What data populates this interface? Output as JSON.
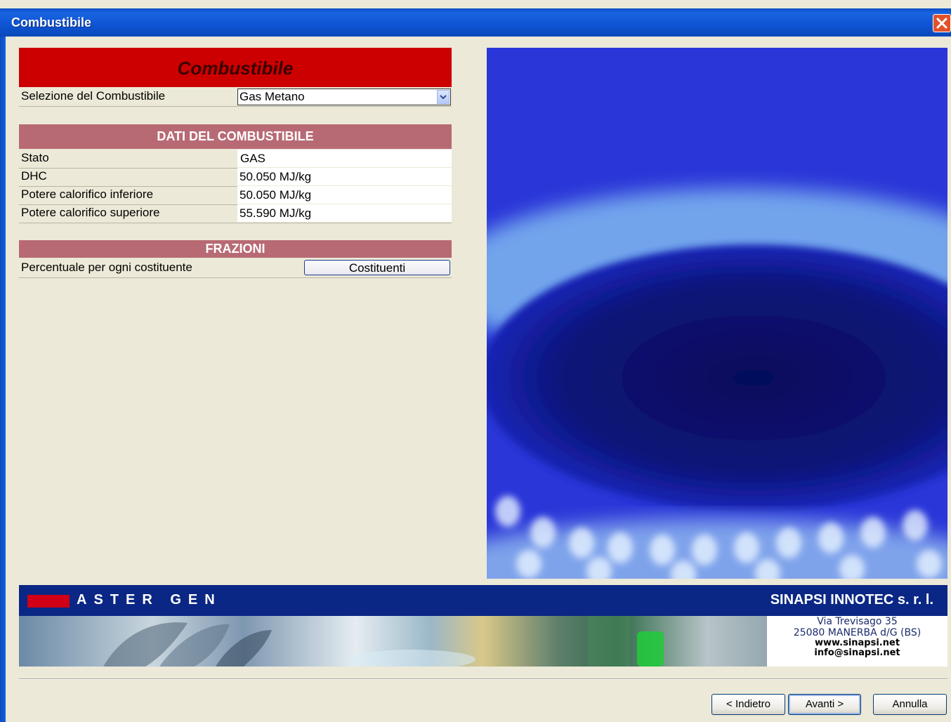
{
  "window": {
    "title": "Combustibile",
    "close_icon": "close-icon"
  },
  "header": {
    "title": "Combustibile"
  },
  "fuel_selection": {
    "label": "Selezione del Combustibile",
    "selected": "Gas Metano"
  },
  "fuel_data": {
    "section_title": "DATI DEL COMBUSTIBILE",
    "rows": [
      {
        "label": "Stato",
        "value": "GAS"
      },
      {
        "label": "DHC",
        "value": "50.050 MJ/kg"
      },
      {
        "label": "Potere calorifico inferiore",
        "value": "50.050 MJ/kg"
      },
      {
        "label": "Potere calorifico superiore",
        "value": "55.590 MJ/kg"
      }
    ]
  },
  "fractions": {
    "section_title": "FRAZIONI",
    "label": "Percentuale per ogni costituente",
    "button": "Costituenti"
  },
  "banner": {
    "product": "ASTER GEN",
    "company": "SINAPSI INNOTEC s. r. l.",
    "address_line1": "Via Trevisago 35",
    "address_line2": "25080 MANERBA d/G (BS)",
    "website": "www.sinapsi.net",
    "email": "info@sinapsi.net"
  },
  "buttons": {
    "back": "< Indietro",
    "next": "Avanti >",
    "cancel": "Annulla"
  },
  "colors": {
    "header_red": "#cc0000",
    "section_rose": "#b86a74",
    "banner_blue": "#0b2785",
    "title_blue": "#0f55d6"
  }
}
